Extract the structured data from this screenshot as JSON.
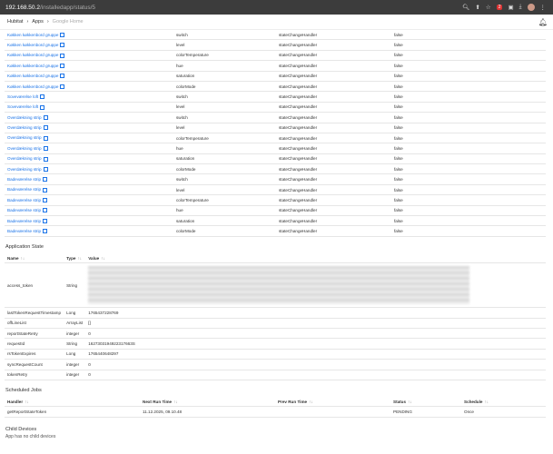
{
  "browser": {
    "host": "192.168.50.2",
    "path": "/installedapp/status/5",
    "badge": "2"
  },
  "breadcrumb": {
    "root": "Hubitat",
    "section": "Apps",
    "current": "Google Home"
  },
  "subscriptions": {
    "rows": [
      {
        "device": "Køkken køkkenbord gruppe",
        "attribute": "switch",
        "handler": "stateChangeHandler",
        "flag": "false"
      },
      {
        "device": "Køkken køkkenbord gruppe",
        "attribute": "level",
        "handler": "stateChangeHandler",
        "flag": "false"
      },
      {
        "device": "Køkken køkkenbord gruppe",
        "attribute": "colorTemperature",
        "handler": "stateChangeHandler",
        "flag": "false"
      },
      {
        "device": "Køkken køkkenbord gruppe",
        "attribute": "hue",
        "handler": "stateChangeHandler",
        "flag": "false"
      },
      {
        "device": "Køkken køkkenbord gruppe",
        "attribute": "saturation",
        "handler": "stateChangeHandler",
        "flag": "false"
      },
      {
        "device": "Køkken køkkenbord gruppe",
        "attribute": "colorMode",
        "handler": "stateChangeHandler",
        "flag": "false"
      },
      {
        "device": "Soveværelse loft",
        "attribute": "switch",
        "handler": "stateChangeHandler",
        "flag": "false"
      },
      {
        "device": "Soveværelse loft",
        "attribute": "level",
        "handler": "stateChangeHandler",
        "flag": "false"
      },
      {
        "device": "Overdækning strip",
        "attribute": "switch",
        "handler": "stateChangeHandler",
        "flag": "false"
      },
      {
        "device": "Overdækning strip",
        "attribute": "level",
        "handler": "stateChangeHandler",
        "flag": "false"
      },
      {
        "device": "Overdækning strip",
        "attribute": "colorTemperature",
        "handler": "stateChangeHandler",
        "flag": "false"
      },
      {
        "device": "Overdækning strip",
        "attribute": "hue",
        "handler": "stateChangeHandler",
        "flag": "false"
      },
      {
        "device": "Overdækning strip",
        "attribute": "saturation",
        "handler": "stateChangeHandler",
        "flag": "false"
      },
      {
        "device": "Overdækning strip",
        "attribute": "colorMode",
        "handler": "stateChangeHandler",
        "flag": "false"
      },
      {
        "device": "Badeværelse strip",
        "attribute": "switch",
        "handler": "stateChangeHandler",
        "flag": "false"
      },
      {
        "device": "Badeværelse strip",
        "attribute": "level",
        "handler": "stateChangeHandler",
        "flag": "false"
      },
      {
        "device": "Badeværelse strip",
        "attribute": "colorTemperature",
        "handler": "stateChangeHandler",
        "flag": "false"
      },
      {
        "device": "Badeværelse strip",
        "attribute": "hue",
        "handler": "stateChangeHandler",
        "flag": "false"
      },
      {
        "device": "Badeværelse strip",
        "attribute": "saturation",
        "handler": "stateChangeHandler",
        "flag": "false"
      },
      {
        "device": "Badeværelse strip",
        "attribute": "colorMode",
        "handler": "stateChangeHandler",
        "flag": "false"
      }
    ]
  },
  "app_state": {
    "title": "Application State",
    "headers": {
      "name": "Name",
      "type": "Type",
      "value": "Value"
    },
    "rows": [
      {
        "name": "access_token",
        "type": "String",
        "value": ""
      },
      {
        "name": "lastTokenRequestTimestamp",
        "type": "Long",
        "value": "1765437228769"
      },
      {
        "name": "offLineList",
        "type": "ArrayList",
        "value": "[]"
      },
      {
        "name": "reportStateRetry",
        "type": "integer",
        "value": "0"
      },
      {
        "name": "requestId",
        "type": "String",
        "value": "1627303194922317663S"
      },
      {
        "name": "rsTokenExpires",
        "type": "Long",
        "value": "1765440648297"
      },
      {
        "name": "syncRequestCount",
        "type": "integer",
        "value": "0"
      },
      {
        "name": "tokenRetry",
        "type": "integer",
        "value": "0"
      }
    ]
  },
  "scheduled_jobs": {
    "title": "Scheduled Jobs",
    "headers": {
      "handler": "Handler",
      "next": "Next Run Time",
      "prev": "Prev Run Time",
      "status": "Status",
      "schedule": "Schedule"
    },
    "rows": [
      {
        "handler": "getReportStateToken",
        "next": "11.12.2025, 09.10.48",
        "prev": "",
        "status": "PENDING",
        "schedule": "Once"
      }
    ]
  },
  "child_devices": {
    "title": "Child Devices",
    "note": "App has no child devices"
  },
  "colors": {
    "link": "#1a73e8"
  }
}
